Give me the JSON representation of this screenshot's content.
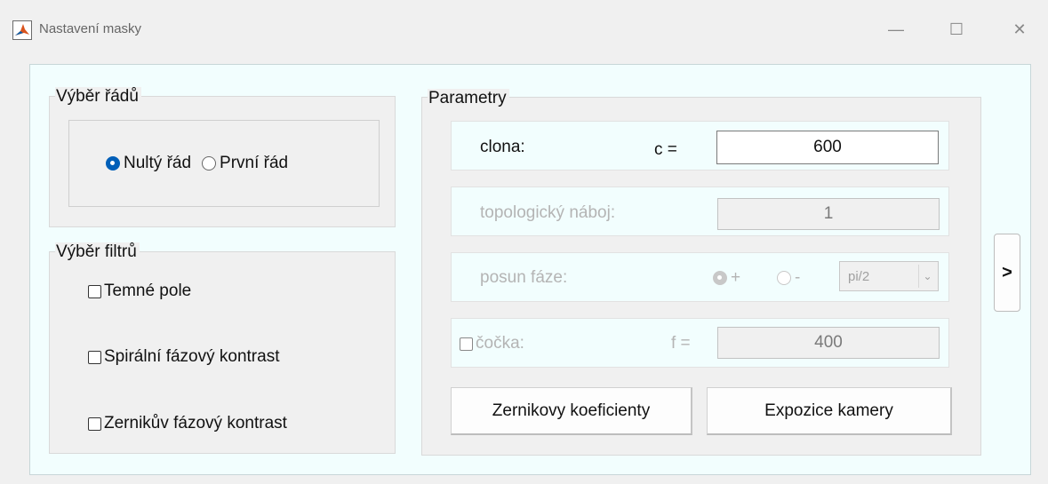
{
  "window": {
    "title": "Nastavení masky",
    "controls": {
      "minimize": "—",
      "maximize": "☐",
      "close": "✕"
    }
  },
  "orders_panel": {
    "title": "Výběr řádů",
    "options": [
      {
        "label": "Nultý řád",
        "selected": true
      },
      {
        "label": "První řád",
        "selected": false
      }
    ]
  },
  "filters_panel": {
    "title": "Výběr filtrů",
    "items": [
      {
        "label": "Temné pole",
        "checked": false
      },
      {
        "label": "Spirální fázový kontrast",
        "checked": false
      },
      {
        "label": "Zernikův fázový kontrast",
        "checked": false
      }
    ]
  },
  "params_panel": {
    "title": "Parametry",
    "aperture": {
      "label": "clona:",
      "symbol": "c =",
      "value": "600"
    },
    "topo_charge": {
      "label": "topologický náboj:",
      "value": "1"
    },
    "phase_shift": {
      "label": "posun fáze:",
      "plus": "+",
      "minus": "-",
      "selected": "+",
      "select_value": "pi/2"
    },
    "lens": {
      "label": "čočka:",
      "symbol": "f =",
      "value": "400",
      "checked": false
    },
    "zernike_button": "Zernikovy koeficienty",
    "exposure_button": "Expozice kamery"
  },
  "expand_button": ">",
  "colors": {
    "accent": "#005fb8",
    "content_bg": "#f2fefe",
    "panel_bg": "#f0f0f0",
    "disabled_text": "#b4b4b4"
  }
}
